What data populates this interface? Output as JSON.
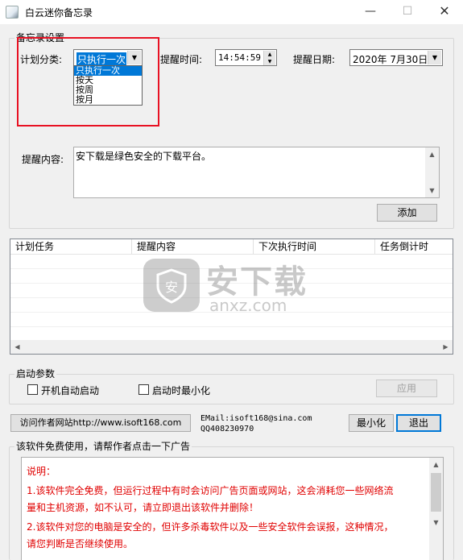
{
  "window": {
    "title": "白云迷你备忘录",
    "minimize_glyph": "—",
    "maximize_glyph": "☐",
    "close_glyph": "✕"
  },
  "settings": {
    "group_label": "备忘录设置",
    "plan_type_label": "计划分类:",
    "plan_type_value": "只执行一次",
    "plan_type_options": [
      "只执行一次",
      "按天",
      "按周",
      "按月"
    ],
    "remind_time_label": "提醒时间:",
    "remind_time_value": "14:54:59",
    "remind_date_label": "提醒日期:",
    "remind_date_value": "2020年 7月30日",
    "content_label": "提醒内容:",
    "content_value": "安下载是绿色安全的下载平台。",
    "add_button": "添加"
  },
  "task_list": {
    "columns": [
      "计划任务",
      "提醒内容",
      "下次执行时间",
      "任务倒计时"
    ]
  },
  "watermark": {
    "text": "安下载",
    "domain": "anxz.com"
  },
  "startup": {
    "group_label": "启动参数",
    "auto_start_label": "开机自动启动",
    "minimize_on_start_label": "启动时最小化",
    "apply_button": "应用"
  },
  "footer": {
    "visit_button": "访问作者网站http://www.isoft168.com",
    "email": "EMail:isoft168@sina.com",
    "qq": "QQ408230970",
    "minimize_button": "最小化",
    "exit_button": "退出"
  },
  "ad": {
    "group_label": "该软件免费使用，请帮作者点击一下广告",
    "lines": [
      "说明：",
      "1.该软件完全免费，但运行过程中有时会访问广告页面或网站，这会消耗您一些网络流",
      "量和主机资源，如不认可，请立即退出该软件并删除！",
      "2.该软件对您的电脑是安全的，但许多杀毒软件以及一些安全软件会误报，这种情况，",
      "请您判断是否继续使用。"
    ]
  },
  "colors": {
    "highlight": "#e81123",
    "selection": "#0078d7",
    "ad_text": "#e00000"
  }
}
